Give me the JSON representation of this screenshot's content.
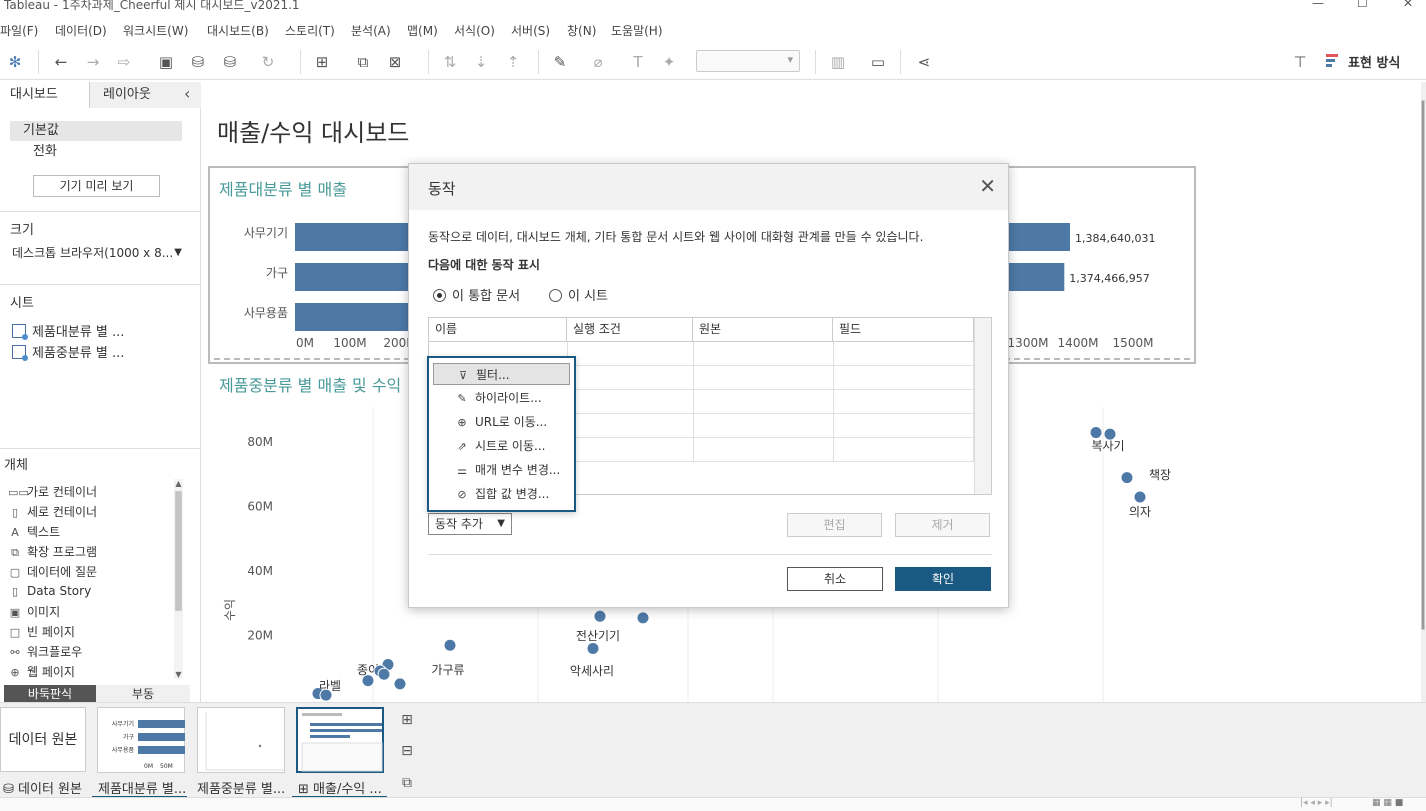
{
  "window": {
    "title": "Tableau - 1주차과제_Cheerful 제시 대시보드_v2021.1",
    "controls": [
      "—",
      "☐",
      "✕"
    ]
  },
  "menu": [
    "파일(F)",
    "데이터(D)",
    "워크시트(W)",
    "대시보드(B)",
    "스토리(T)",
    "분석(A)",
    "맵(M)",
    "서식(O)",
    "서버(S)",
    "창(N)",
    "도움말(H)"
  ],
  "toolbar": {
    "show_me_label": "표현 방식"
  },
  "left_panel": {
    "tabs": [
      "대시보드",
      "레이아웃"
    ],
    "collapse_glyph": "‹",
    "device_items": [
      "기본값",
      "전화"
    ],
    "preview_button": "기기 미리 보기",
    "size_title": "크기",
    "size_value": "데스크톱 브라우저(1000 x 8...",
    "sheets_title": "시트",
    "sheets": [
      "제품대분류 별 ...",
      "제품중분류 별 ..."
    ],
    "objects_title": "개체",
    "objects": [
      {
        "icon": "horizontal-container-icon",
        "glyph": "▭▭",
        "label": "가로 컨테이너"
      },
      {
        "icon": "vertical-container-icon",
        "glyph": "▯",
        "label": "세로 컨테이너"
      },
      {
        "icon": "text-icon",
        "glyph": "A",
        "label": "텍스트"
      },
      {
        "icon": "extension-icon",
        "glyph": "⧉",
        "label": "확장 프로그램"
      },
      {
        "icon": "ask-data-icon",
        "glyph": "▢",
        "label": "데이터에 질문"
      },
      {
        "icon": "data-story-icon",
        "glyph": "▯",
        "label": "Data Story"
      },
      {
        "icon": "image-icon",
        "glyph": "▣",
        "label": "이미지"
      },
      {
        "icon": "blank-icon",
        "glyph": "□",
        "label": "빈 페이지"
      },
      {
        "icon": "workflow-icon",
        "glyph": "⚯",
        "label": "워크플로우"
      },
      {
        "icon": "web-page-icon",
        "glyph": "⊕",
        "label": "웹 페이지"
      }
    ],
    "layout_tabs": [
      "바둑판식",
      "부동"
    ]
  },
  "dashboard": {
    "title": "매출/수익 대시보드",
    "chart1_title": "제품대분류 별 매출",
    "chart2_title": "제품중분류 별 매출 및 수익"
  },
  "chart_data": [
    {
      "type": "bar",
      "categories": [
        "사무기기",
        "가구",
        "사무용품"
      ],
      "values": [
        1384640031,
        1374466957,
        null
      ],
      "value_labels": [
        "1,384,640,031",
        "1,374,466,957",
        ""
      ],
      "xticks": [
        "0M",
        "100M",
        "200M",
        "1300M",
        "1400M",
        "1500M"
      ],
      "xlim": [
        0,
        1500000000
      ]
    },
    {
      "type": "scatter",
      "ylabel": "수익",
      "yticks": [
        "80M",
        "60M",
        "40M",
        "20M"
      ],
      "ylim": [
        0,
        90000000
      ],
      "points": [
        {
          "label": "복사기",
          "y": 83000000
        },
        {
          "label": "",
          "y": 82500000
        },
        {
          "label": "책장",
          "y": 69000000
        },
        {
          "label": "의자",
          "y": 63000000
        },
        {
          "label": "전산기기",
          "y": 26000000
        },
        {
          "label": "",
          "y": 25500000
        },
        {
          "label": "악세사리",
          "y": 16000000
        },
        {
          "label": "가구류",
          "y": 17000000
        },
        {
          "label": "종이",
          "y": 11000000
        },
        {
          "label": "",
          "y": 9000000
        },
        {
          "label": "",
          "y": 8000000
        },
        {
          "label": "",
          "y": 6000000
        },
        {
          "label": "",
          "y": 5000000
        },
        {
          "label": "라벨",
          "y": 2000000
        },
        {
          "label": "",
          "y": 1500000
        }
      ]
    }
  ],
  "dialog": {
    "title": "동작",
    "description": "동작으로 데이터, 대시보드 개체, 기타 통합 문서 시트와 웹 사이에 대화형 관계를 만들 수 있습니다.",
    "show_for": "다음에 대한 동작 표시",
    "radio_workbook": "이 통합 문서",
    "radio_sheet": "이 시트",
    "columns": [
      "이름",
      "실행 조건",
      "원본",
      "필드"
    ],
    "add_action": "동작 추가",
    "edit": "편집",
    "remove": "제거",
    "cancel": "취소",
    "ok": "확인"
  },
  "action_menu": [
    {
      "icon": "filter-icon",
      "glyph": "⊽",
      "label": "필터..."
    },
    {
      "icon": "highlight-icon",
      "glyph": "✎",
      "label": "하이라이트..."
    },
    {
      "icon": "url-icon",
      "glyph": "⊕",
      "label": "URL로 이동..."
    },
    {
      "icon": "sheet-goto-icon",
      "glyph": "⇗",
      "label": "시트로 이동..."
    },
    {
      "icon": "parameter-icon",
      "glyph": "⚌",
      "label": "매개 변수 변경..."
    },
    {
      "icon": "set-icon",
      "glyph": "⊘",
      "label": "집합 값 변경..."
    }
  ],
  "bottom": {
    "data_source_box": "데이터 원본",
    "tabs": [
      "데이터 원본",
      "제품대분류 별...",
      "제품중분류 별...",
      "매출/수익 ..."
    ],
    "thumb1_labels": [
      "사무기기",
      "가구",
      "사무용품"
    ],
    "thumb1_ticks": [
      "0M",
      "50M"
    ]
  }
}
